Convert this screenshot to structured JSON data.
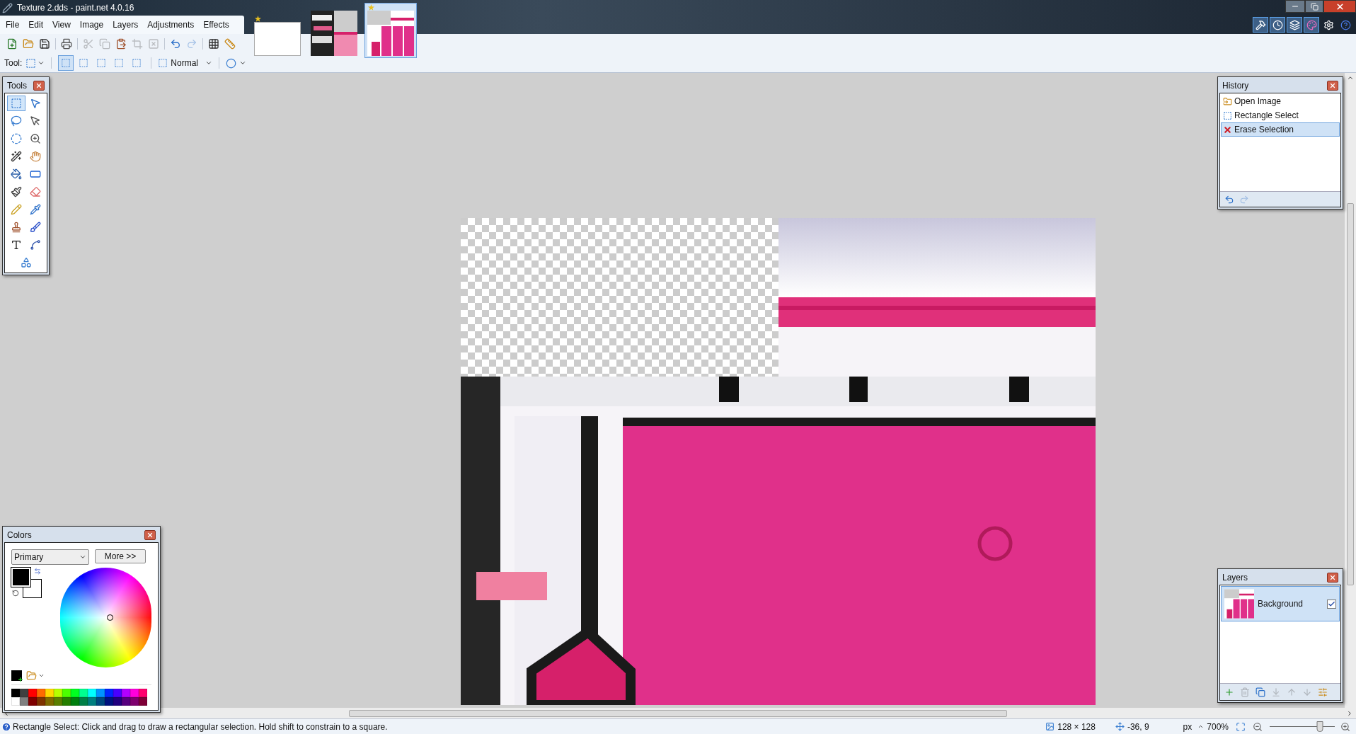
{
  "window": {
    "title": "Texture 2.dds - paint.net 4.0.16"
  },
  "menu": [
    "File",
    "Edit",
    "View",
    "Image",
    "Layers",
    "Adjustments",
    "Effects"
  ],
  "image_tabs": [
    {
      "kind": "blank",
      "modified": true,
      "selected": false
    },
    {
      "kind": "texture-a",
      "modified": false,
      "selected": false
    },
    {
      "kind": "texture-b",
      "modified": true,
      "selected": true
    }
  ],
  "panel_toggles": [
    {
      "kind": "tools",
      "on": true
    },
    {
      "kind": "history",
      "on": true
    },
    {
      "kind": "layers",
      "on": true
    },
    {
      "kind": "colors",
      "on": true
    },
    {
      "kind": "settings",
      "on": false
    },
    {
      "kind": "help",
      "on": false
    }
  ],
  "toolbar_buttons": [
    {
      "kind": "new",
      "disabled": false
    },
    {
      "kind": "open",
      "disabled": false
    },
    {
      "kind": "save",
      "disabled": false
    },
    {
      "kind": "print",
      "disabled": false
    },
    {
      "kind": "cut",
      "disabled": true
    },
    {
      "kind": "copy",
      "disabled": true
    },
    {
      "kind": "paste",
      "disabled": false
    },
    {
      "kind": "crop",
      "disabled": true
    },
    {
      "kind": "deselect",
      "disabled": true
    },
    {
      "kind": "undo",
      "disabled": false
    },
    {
      "kind": "redo",
      "disabled": true
    },
    {
      "kind": "grid",
      "disabled": false
    },
    {
      "kind": "rulers",
      "disabled": false
    }
  ],
  "tool_bar": {
    "label": "Tool:",
    "selection_modes": [
      {
        "selected": true
      },
      {
        "selected": false
      },
      {
        "selected": false
      },
      {
        "selected": false
      },
      {
        "selected": false
      }
    ],
    "blend_mode": "Normal"
  },
  "tools_panel": {
    "title": "Tools",
    "tools": [
      {
        "kind": "rectangle-select",
        "selected": true
      },
      {
        "kind": "move-selected",
        "selected": false
      },
      {
        "kind": "lasso",
        "selected": false
      },
      {
        "kind": "move-selection",
        "selected": false
      },
      {
        "kind": "ellipse-select",
        "selected": false
      },
      {
        "kind": "zoom",
        "selected": false
      },
      {
        "kind": "magic-wand",
        "selected": false
      },
      {
        "kind": "pan",
        "selected": false
      },
      {
        "kind": "paint-bucket",
        "selected": false
      },
      {
        "kind": "gradient",
        "selected": false
      },
      {
        "kind": "paintbrush",
        "selected": false
      },
      {
        "kind": "eraser",
        "selected": false
      },
      {
        "kind": "pencil",
        "selected": false
      },
      {
        "kind": "color-picker",
        "selected": false
      },
      {
        "kind": "clone-stamp",
        "selected": false
      },
      {
        "kind": "recolor",
        "selected": false
      },
      {
        "kind": "text",
        "selected": false
      },
      {
        "kind": "line-curve",
        "selected": false
      },
      {
        "kind": "shapes",
        "selected": false
      }
    ]
  },
  "history": {
    "title": "History",
    "items": [
      {
        "kind": "open",
        "label": "Open Image",
        "selected": false
      },
      {
        "kind": "select",
        "label": "Rectangle Select",
        "selected": false
      },
      {
        "kind": "erase",
        "label": "Erase Selection",
        "selected": true
      }
    ],
    "buttons": [
      {
        "kind": "undo",
        "disabled": false
      },
      {
        "kind": "redo",
        "disabled": true
      }
    ]
  },
  "colors": {
    "title": "Colors",
    "dropdown": "Primary",
    "more_button": "More >>",
    "swatches": [
      {
        "kind": "primary",
        "color": "#000000"
      },
      {
        "kind": "secondary",
        "color": "#ffffff"
      }
    ],
    "palette": [
      {
        "color": "#000000"
      },
      {
        "color": "#404040"
      },
      {
        "color": "#ff0000"
      },
      {
        "color": "#ff6a00"
      },
      {
        "color": "#ffd800"
      },
      {
        "color": "#b6ff00"
      },
      {
        "color": "#4cff00"
      },
      {
        "color": "#00ff21"
      },
      {
        "color": "#00ff90"
      },
      {
        "color": "#00ffff"
      },
      {
        "color": "#0094ff"
      },
      {
        "color": "#0026ff"
      },
      {
        "color": "#4800ff"
      },
      {
        "color": "#b200ff"
      },
      {
        "color": "#ff00dc"
      },
      {
        "color": "#ff006e"
      },
      {
        "color": "#ffffff"
      },
      {
        "color": "#808080"
      },
      {
        "color": "#7f0000"
      },
      {
        "color": "#7f3300"
      },
      {
        "color": "#7f6a00"
      },
      {
        "color": "#5b7f00"
      },
      {
        "color": "#267f00"
      },
      {
        "color": "#007f0e"
      },
      {
        "color": "#007f46"
      },
      {
        "color": "#007f7f"
      },
      {
        "color": "#004a7f"
      },
      {
        "color": "#00137f"
      },
      {
        "color": "#21007f"
      },
      {
        "color": "#57007f"
      },
      {
        "color": "#7f006e"
      },
      {
        "color": "#7f0037"
      }
    ]
  },
  "layers": {
    "title": "Layers",
    "items": [
      {
        "name": "Background",
        "visible": true,
        "selected": true
      }
    ],
    "buttons": [
      {
        "kind": "add",
        "disabled": false
      },
      {
        "kind": "delete",
        "disabled": true
      },
      {
        "kind": "duplicate",
        "disabled": false
      },
      {
        "kind": "merge-down",
        "disabled": true
      },
      {
        "kind": "move-up",
        "disabled": true
      },
      {
        "kind": "move-down",
        "disabled": true
      },
      {
        "kind": "properties",
        "disabled": false
      }
    ]
  },
  "status_bar": {
    "message": "Rectangle Select: Click and drag to draw a rectangular selection. Hold shift to constrain to a square.",
    "image_size": "128 × 128",
    "cursor_position": "-36, 9",
    "units": "px",
    "zoom": "700%",
    "zoom_slider": {
      "level": 0.77
    }
  }
}
